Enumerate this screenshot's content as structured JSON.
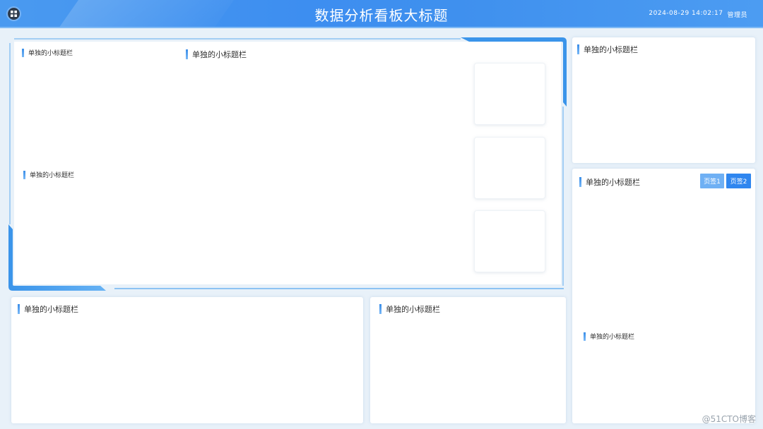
{
  "header": {
    "title": "数据分析看板大标题",
    "datetime": "2024-08-29 14:02:17",
    "user": "管理员",
    "menu_icon": "grid-icon"
  },
  "main": {
    "title_top_left": "单独的小标题栏",
    "title_top_center": "单独的小标题栏",
    "title_mid_left": "单独的小标题栏"
  },
  "right_top": {
    "title": "单独的小标题栏"
  },
  "right_bottom": {
    "title": "单独的小标题栏",
    "tabs": [
      "页签1",
      "页签2"
    ],
    "inner_title": "单独的小标题栏"
  },
  "bottom_left": {
    "title": "单独的小标题栏"
  },
  "bottom_middle": {
    "title": "单独的小标题栏"
  },
  "watermark": "@51CTO博客",
  "colors": {
    "accent": "#3d8ef0",
    "frame": "#3a94ea",
    "tab_active": "#2f86ef",
    "tab_inactive": "#6fb0f4"
  }
}
